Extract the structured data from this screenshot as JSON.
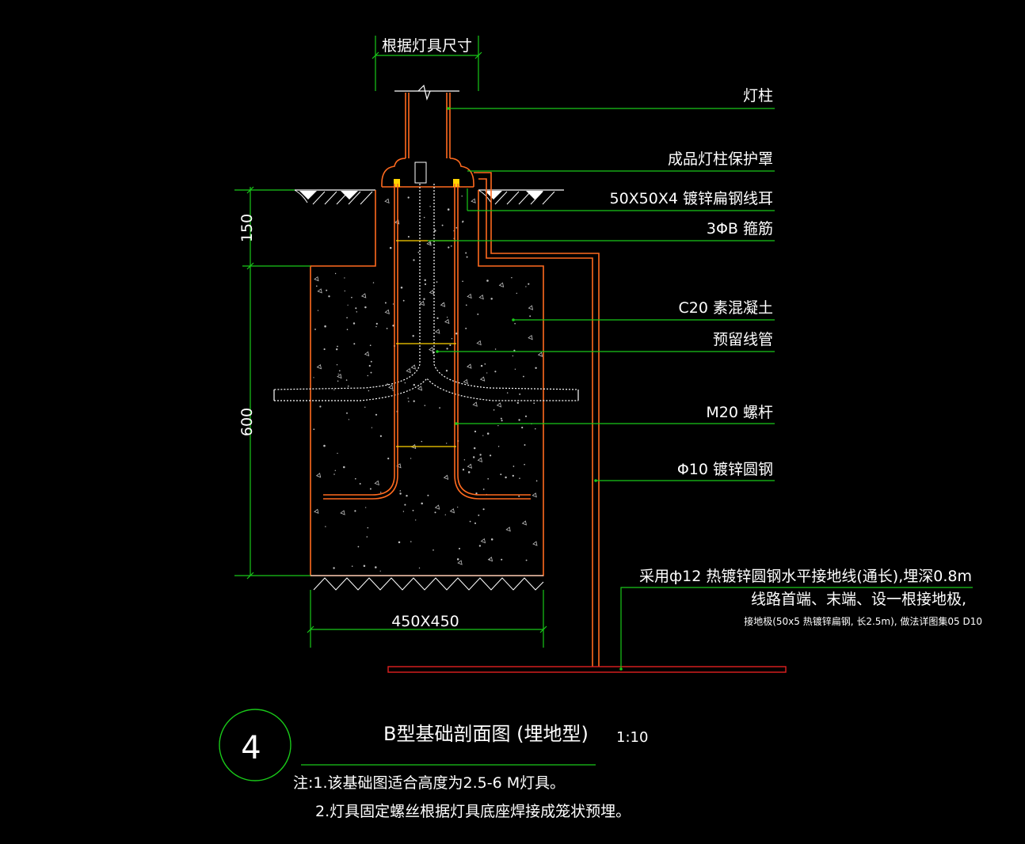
{
  "dimensions": {
    "top_width": "根据灯具尺寸",
    "depth_upper": "150",
    "depth_lower": "600",
    "base_size": "450X450"
  },
  "leaders": [
    "灯柱",
    "成品灯柱保护罩",
    "50X50X4 镀锌扁钢线耳",
    "3ΦB 箍筋",
    "C20 素混凝土",
    "预留线管",
    "M20 螺杆",
    "Φ10 镀锌圆钢"
  ],
  "ground_note": {
    "line1": "采用ф12 热镀锌圆钢水平接地线(通长),埋深0.8m",
    "line2": "线路首端、末端、设一根接地极,",
    "line3": "接地极(50x5 热镀锌扁钢, 长2.5m), 做法详图集05 D10"
  },
  "title_block": {
    "number": "4",
    "title": "B型基础剖面图 (埋地型)",
    "scale": "1:10"
  },
  "notes": [
    "注:1.该基础图适合高度为2.5-6 M灯具。",
    "2.灯具固定螺丝根据灯具底座焊接成笼状预埋。"
  ],
  "colors": {
    "background": "#000000",
    "dimension": "#19c819",
    "pole": "#ff6a1f",
    "ground_wire": "#e02020",
    "text": "#ffffff"
  }
}
